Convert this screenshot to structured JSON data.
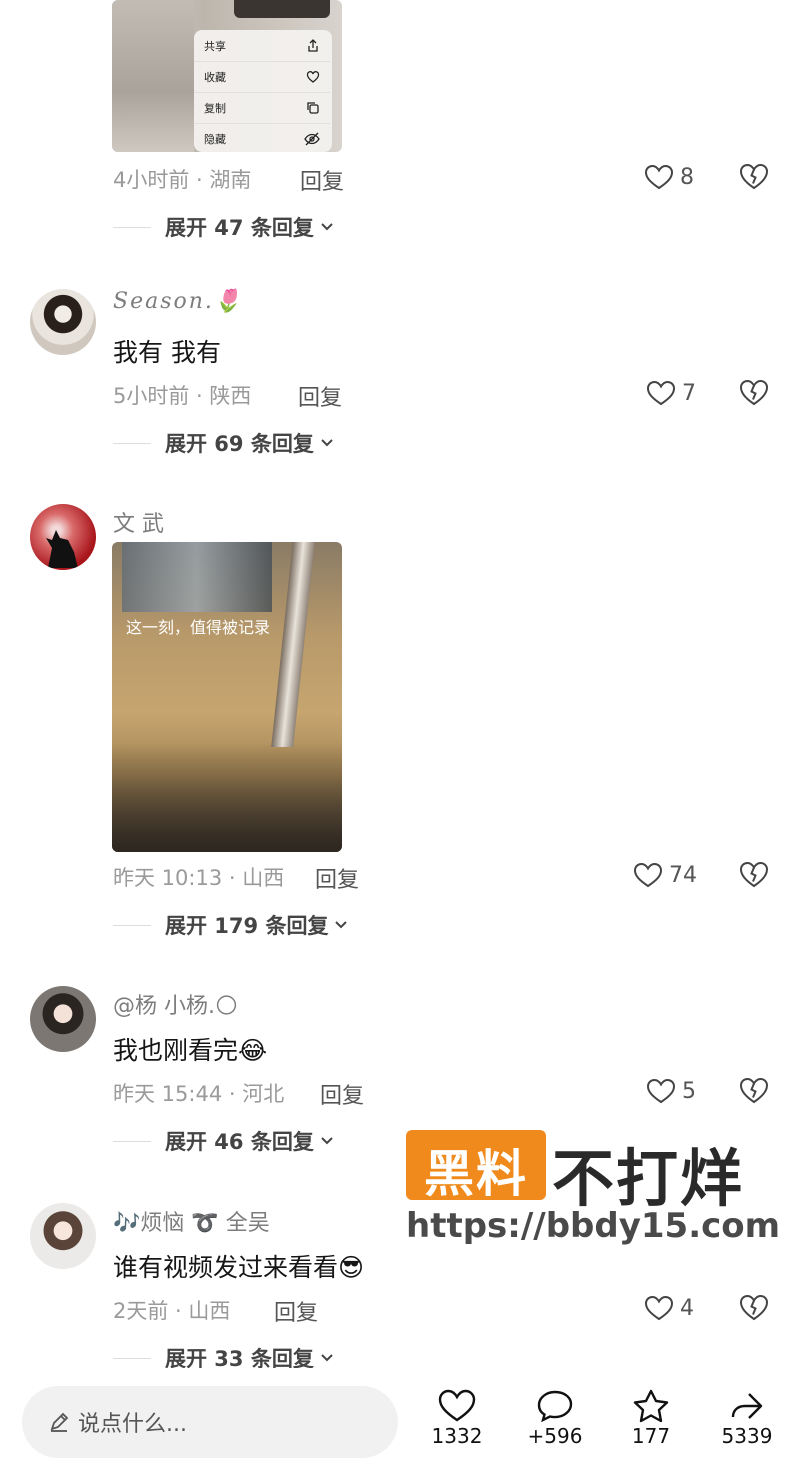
{
  "top_thumbnail": {
    "menu": [
      {
        "label": "共享",
        "icon": "share-icon"
      },
      {
        "label": "收藏",
        "icon": "heart-outline-icon"
      },
      {
        "label": "复制",
        "icon": "copy-icon"
      },
      {
        "label": "隐藏",
        "icon": "eye-hidden-icon"
      }
    ]
  },
  "comments": [
    {
      "meta": "4小时前 · 湖南",
      "reply": "回复",
      "likes": "8",
      "expand": "展开 47 条回复"
    },
    {
      "name": "Season.",
      "name_emoji": "🌷",
      "text": "我有 我有",
      "meta": "5小时前 · 陕西",
      "reply": "回复",
      "likes": "7",
      "expand": "展开 69 条回复"
    },
    {
      "name": "文 武",
      "video_caption": "这一刻，值得被记录",
      "meta": "昨天 10:13 · 山西",
      "reply": "回复",
      "likes": "74",
      "expand": "展开 179 条回复"
    },
    {
      "name": "@杨 小杨.",
      "name_emoji": "🌕",
      "text": "我也刚看完",
      "text_emoji": "😂",
      "meta": "昨天 15:44 · 河北",
      "reply": "回复",
      "likes": "5",
      "expand": "展开 46 条回复"
    },
    {
      "name": "🎶烦恼 ➰ 全吴",
      "text": "谁有视频发过来看看",
      "text_emoji": "😎",
      "meta": "2天前 · 山西",
      "reply": "回复",
      "likes": "4",
      "expand": "展开 33 条回复"
    }
  ],
  "watermark": {
    "box": "黑料",
    "text": "不打烊",
    "url": "https://bbdy15.com"
  },
  "bottom_bar": {
    "input_placeholder": "说点什么...",
    "actions": [
      {
        "icon": "heart-icon",
        "count": "1332"
      },
      {
        "icon": "comment-icon",
        "count": "+596"
      },
      {
        "icon": "star-icon",
        "count": "177"
      },
      {
        "icon": "share-arrow-icon",
        "count": "5339"
      }
    ]
  },
  "colors": {
    "watermark_orange": "#f08a1c",
    "text_primary": "#161616",
    "text_secondary": "#9a9a9a"
  }
}
